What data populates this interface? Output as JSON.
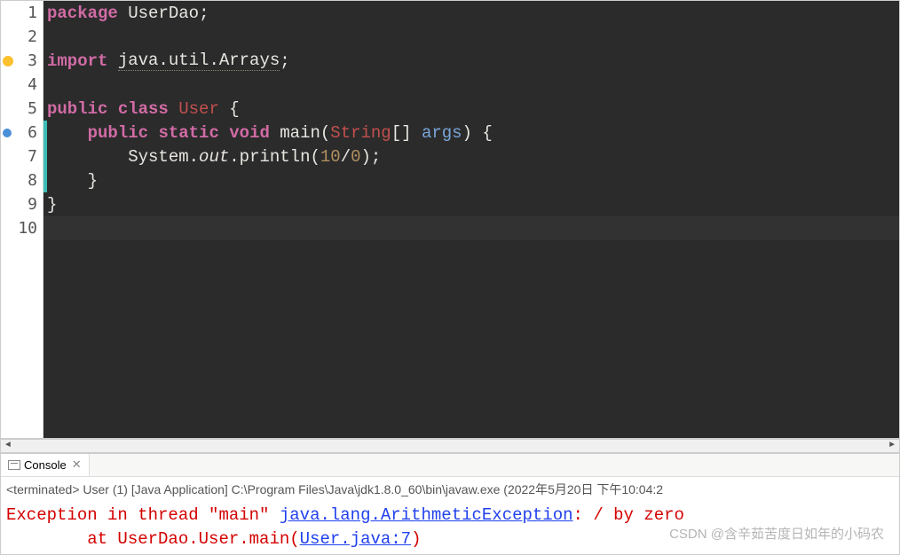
{
  "code": {
    "lines": [
      {
        "n": "1",
        "marker": null,
        "tokens": [
          [
            "kw",
            "package"
          ],
          [
            "punct",
            " "
          ],
          [
            "id",
            "UserDao"
          ],
          [
            "punct",
            ";"
          ]
        ]
      },
      {
        "n": "2",
        "marker": null,
        "tokens": []
      },
      {
        "n": "3",
        "marker": "warn",
        "tokens": [
          [
            "kw",
            "import"
          ],
          [
            "punct",
            " "
          ],
          [
            "id underline",
            "java.util.Arrays"
          ],
          [
            "punct",
            ";"
          ]
        ]
      },
      {
        "n": "4",
        "marker": null,
        "tokens": []
      },
      {
        "n": "5",
        "marker": null,
        "tokens": [
          [
            "kw",
            "public"
          ],
          [
            "punct",
            " "
          ],
          [
            "kw",
            "class"
          ],
          [
            "punct",
            " "
          ],
          [
            "cls",
            "User"
          ],
          [
            "punct",
            " {"
          ]
        ]
      },
      {
        "n": "6",
        "marker": "circle",
        "aqua": true,
        "tokens": [
          [
            "punct",
            "    "
          ],
          [
            "kw",
            "public"
          ],
          [
            "punct",
            " "
          ],
          [
            "kw",
            "static"
          ],
          [
            "punct",
            " "
          ],
          [
            "kw",
            "void"
          ],
          [
            "punct",
            " "
          ],
          [
            "method",
            "main"
          ],
          [
            "punct",
            "("
          ],
          [
            "type",
            "String"
          ],
          [
            "punct",
            "[] "
          ],
          [
            "param",
            "args"
          ],
          [
            "punct",
            ") {"
          ]
        ]
      },
      {
        "n": "7",
        "marker": null,
        "aqua": true,
        "tokens": [
          [
            "punct",
            "        "
          ],
          [
            "id",
            "System"
          ],
          [
            "punct",
            "."
          ],
          [
            "id italic",
            "out"
          ],
          [
            "punct",
            "."
          ],
          [
            "method",
            "println"
          ],
          [
            "punct",
            "("
          ],
          [
            "num",
            "10"
          ],
          [
            "punct",
            "/"
          ],
          [
            "num",
            "0"
          ],
          [
            "punct",
            ");"
          ]
        ]
      },
      {
        "n": "8",
        "marker": null,
        "aqua": true,
        "tokens": [
          [
            "punct",
            "    }"
          ]
        ]
      },
      {
        "n": "9",
        "marker": null,
        "tokens": [
          [
            "punct",
            "}"
          ]
        ]
      },
      {
        "n": "10",
        "marker": null,
        "highlight": true,
        "tokens": []
      }
    ]
  },
  "console": {
    "tab_label": "Console",
    "status": "<terminated> User (1) [Java Application] C:\\Program Files\\Java\\jdk1.8.0_60\\bin\\javaw.exe (2022年5月20日 下午10:04:2",
    "line1_a": "Exception in thread \"main\" ",
    "line1_b": "java.lang.ArithmeticException",
    "line1_c": ": / by zero",
    "line2_a": "        at UserDao.User.main(",
    "line2_b": "User.java:7",
    "line2_c": ")"
  },
  "watermark": "CSDN @含辛茹苦度日如年的小码农"
}
